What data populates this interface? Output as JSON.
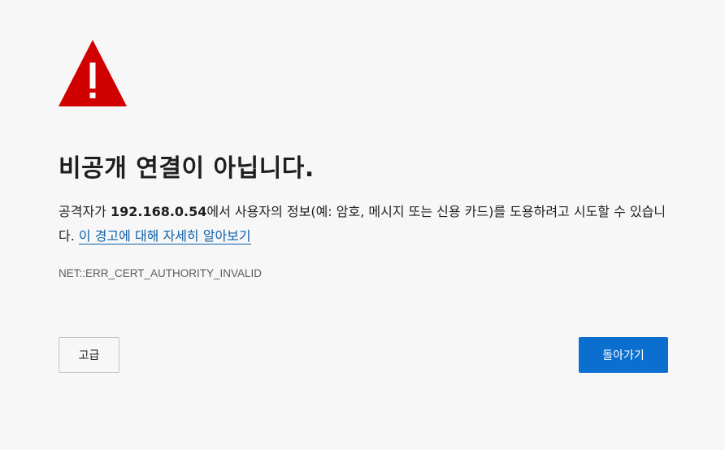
{
  "icons": {
    "warning": "warning-triangle-icon"
  },
  "colors": {
    "warning_red": "#d10000",
    "link_blue": "#0b5fa8",
    "primary_button": "#0a6fcf"
  },
  "error_page": {
    "title": "비공개 연결이 아닙니다.",
    "message_prefix": "공격자가 ",
    "host": "192.168.0.54",
    "message_suffix": "에서 사용자의 정보(예: 암호, 메시지 또는 신용 카드)를 도용하려고 시도할 수 있습니다. ",
    "learn_more_link": "이 경고에 대해 자세히 알아보기",
    "error_code": "NET::ERR_CERT_AUTHORITY_INVALID"
  },
  "buttons": {
    "advanced_label": "고급",
    "go_back_label": "돌아가기"
  }
}
